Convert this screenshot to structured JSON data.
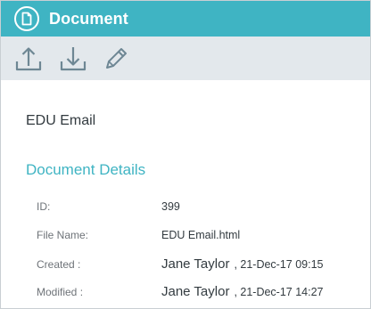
{
  "header": {
    "title": "Document",
    "icon": "document-icon",
    "color": "#3fb4c3"
  },
  "toolbar": {
    "items": [
      {
        "name": "upload",
        "icon": "upload-icon"
      },
      {
        "name": "download",
        "icon": "download-icon"
      },
      {
        "name": "edit",
        "icon": "pencil-icon"
      }
    ],
    "background": "#e3e8ec"
  },
  "document": {
    "name": "EDU Email"
  },
  "details": {
    "title": "Document Details",
    "id": {
      "label": "ID:",
      "value": "399"
    },
    "file_name": {
      "label": "File Name:",
      "value": "EDU Email.html"
    },
    "created": {
      "label": "Created :",
      "user": "Jane Taylor",
      "date": ", 21-Dec-17 09:15"
    },
    "modified": {
      "label": "Modified :",
      "user": "Jane Taylor",
      "date": ", 21-Dec-17 14:27"
    }
  }
}
